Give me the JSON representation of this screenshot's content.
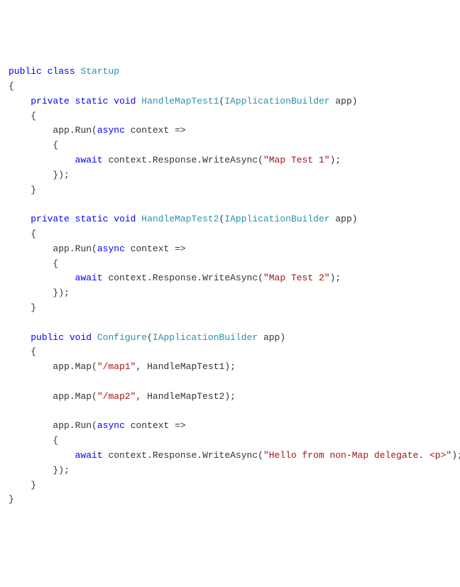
{
  "code": {
    "keywords": {
      "public": "public",
      "class": "class",
      "private": "private",
      "static": "static",
      "void": "void",
      "async": "async",
      "await": "await"
    },
    "types": {
      "Startup": "Startup",
      "IApplicationBuilder": "IApplicationBuilder"
    },
    "methods": {
      "HandleMapTest1": "HandleMapTest1",
      "HandleMapTest2": "HandleMapTest2",
      "Configure": "Configure"
    },
    "identifiers": {
      "app": "app",
      "context": "context",
      "Run": "Run",
      "Response": "Response",
      "WriteAsync": "WriteAsync",
      "Map": "Map"
    },
    "strings": {
      "mapTest1": "\"Map Test 1\"",
      "mapTest2": "\"Map Test 2\"",
      "map1": "\"/map1\"",
      "map2": "\"/map2\"",
      "hello": "\"Hello from non-Map delegate. <p>\""
    },
    "punctuation": {
      "openBrace": "{",
      "closeBrace": "}",
      "openParen": "(",
      "closeParen": ")",
      "semicolon": ";",
      "comma": ",",
      "dot": ".",
      "arrow": "=>",
      "space": " "
    }
  }
}
